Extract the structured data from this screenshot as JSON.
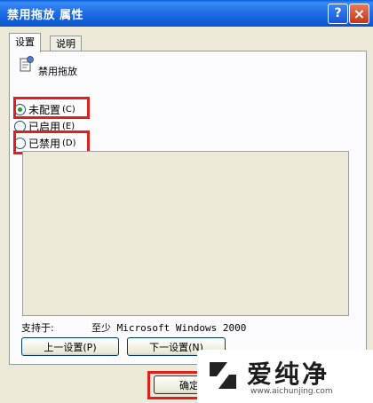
{
  "window": {
    "title": "禁用拖放 属性",
    "help_label": "?",
    "close_label": "×"
  },
  "tabs": [
    {
      "label": "设置",
      "active": true
    },
    {
      "label": "说明",
      "active": false
    }
  ],
  "policy": {
    "icon": "policy-setting-icon",
    "name": "禁用拖放"
  },
  "options": [
    {
      "label": "未配置",
      "accesskey": "(C)",
      "checked": true
    },
    {
      "label": "已启用",
      "accesskey": "(E)",
      "checked": false
    },
    {
      "label": "已禁用",
      "accesskey": "(D)",
      "checked": false
    }
  ],
  "support": {
    "label": "支持于:",
    "value": "至少 Microsoft Windows 2000"
  },
  "buttons": {
    "prev": "上一设置(P)",
    "next": "下一设置(N)",
    "ok": "确定"
  },
  "watermark": {
    "text": "爱纯净",
    "url": "www.aichunjing.com"
  },
  "colors": {
    "highlight": "#e0201d",
    "titlebar": "#0b54cf",
    "radio_dot": "#21a121"
  }
}
